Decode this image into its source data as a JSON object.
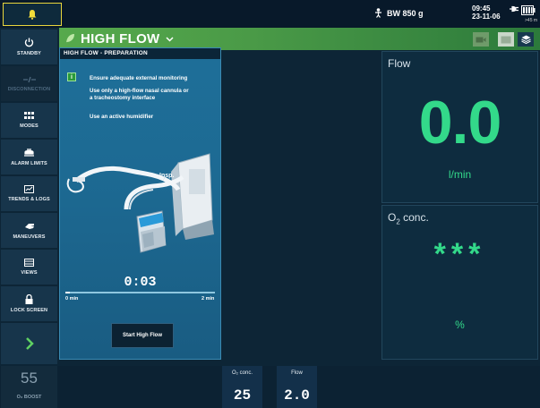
{
  "topbar": {
    "body_weight": "BW 850 g",
    "time": "09:45",
    "date": "23-11-06",
    "battery_text": ">45 m"
  },
  "sidebar": {
    "items": [
      {
        "label": "STANDBY",
        "icon": "power-icon"
      },
      {
        "label": "DISCONNECTION",
        "icon": "disconnection-icon",
        "disabled": true
      },
      {
        "label": "MODES",
        "icon": "grid-icon"
      },
      {
        "label": "ALARM LIMITS",
        "icon": "alarm-limits-icon"
      },
      {
        "label": "TRENDS & LOGS",
        "icon": "trends-icon"
      },
      {
        "label": "MANEUVERS",
        "icon": "hand-icon"
      },
      {
        "label": "VIEWS",
        "icon": "views-icon"
      },
      {
        "label": "LOCK SCREEN",
        "icon": "lock-icon"
      }
    ],
    "next_icon": "chevron-right-icon"
  },
  "mode": {
    "title": "HIGH FLOW",
    "header_buttons": [
      "camera-icon",
      "screen-icon",
      "layers-icon"
    ]
  },
  "prep": {
    "title": "HIGH FLOW - PREPARATION",
    "info_icon_text": "i",
    "lines": [
      "Ensure adequate external monitoring",
      "Use only a high-flow nasal cannula or",
      "a tracheostomy interface",
      "Use an active humidifier"
    ],
    "diagram_label": "Insp.",
    "timer": "0:03",
    "progress_fraction": 0.03,
    "progress_min_label": "0 min",
    "progress_max_label": "2 min",
    "start_button": "Start High Flow"
  },
  "flow_panel": {
    "label": "Flow",
    "value": "0.0",
    "unit": "l/min"
  },
  "o2_panel": {
    "label_main": "O",
    "label_sub": "2",
    "label_rest": " conc.",
    "value": "***",
    "unit": "%"
  },
  "bottom": {
    "o2boost_value": "55",
    "o2boost_label": "O₂ BOOST",
    "settings": [
      {
        "label": "O₂ conc.",
        "value": "25"
      },
      {
        "label": "Flow",
        "value": "2.0"
      }
    ]
  },
  "colors": {
    "accent_green": "#33d98a",
    "header_green": "#4a9a47",
    "alarm_yellow": "#e9d63c",
    "panel_blue": "#1d6a93"
  }
}
